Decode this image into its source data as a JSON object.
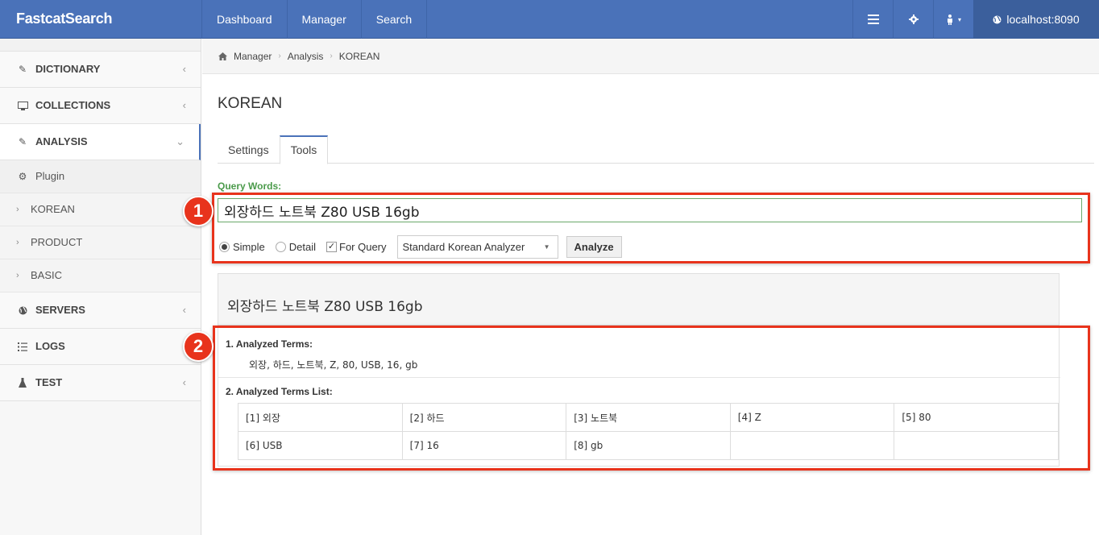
{
  "brand": "FastcatSearch",
  "nav": [
    "Dashboard",
    "Manager",
    "Search"
  ],
  "server": "localhost:8090",
  "sidebar": {
    "items": [
      {
        "label": "DICTIONARY"
      },
      {
        "label": "COLLECTIONS"
      },
      {
        "label": "ANALYSIS"
      },
      {
        "label": "SERVERS"
      },
      {
        "label": "LOGS"
      },
      {
        "label": "TEST"
      }
    ],
    "analysis_sub": {
      "plugin": "Plugin",
      "children": [
        "KOREAN",
        "PRODUCT",
        "BASIC"
      ]
    }
  },
  "breadcrumb": [
    "Manager",
    "Analysis",
    "KOREAN"
  ],
  "page_title": "KOREAN",
  "tabs": [
    "Settings",
    "Tools"
  ],
  "query": {
    "label": "Query Words:",
    "value": "외장하드 노트북 Z80 USB 16gb"
  },
  "options": {
    "simple": "Simple",
    "detail": "Detail",
    "for_query": "For Query",
    "analyzer": "Standard Korean Analyzer",
    "analyze_button": "Analyze"
  },
  "result": {
    "heading": "외장하드 노트북 Z80 USB 16gb",
    "section1_title": "1. Analyzed Terms:",
    "terms": "외장, 하드, 노트북, Z, 80, USB, 16, gb",
    "section2_title": "2. Analyzed Terms List:",
    "list": [
      [
        "[1] 외장",
        "[2] 하드",
        "[3] 노트북",
        "[4] Z",
        "[5] 80"
      ],
      [
        "[6] USB",
        "[7] 16",
        "[8] gb",
        "",
        ""
      ]
    ]
  },
  "annotations": [
    "1",
    "2"
  ],
  "colors": {
    "navbar": "#4a72b9",
    "highlight": "#e8331c",
    "label_green": "#4a9a4a"
  }
}
